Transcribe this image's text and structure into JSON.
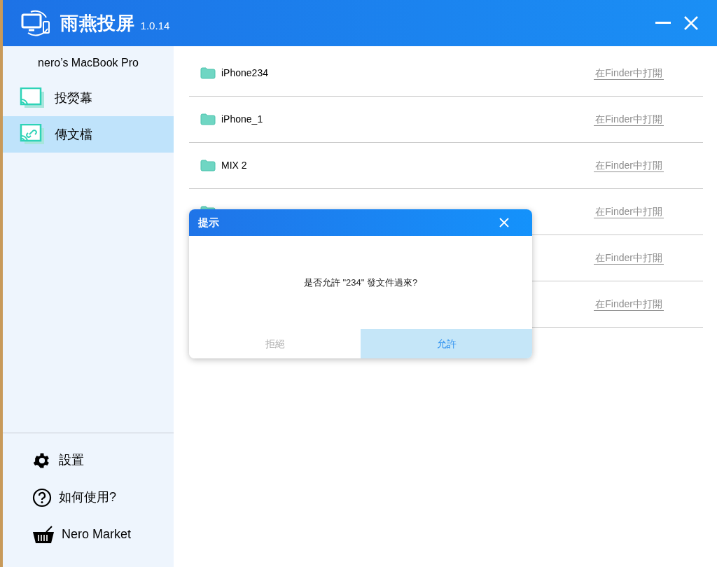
{
  "window": {
    "title": "雨燕投屏",
    "version": "1.0.14"
  },
  "sidebar": {
    "device": "nero’s MacBook Pro",
    "items": [
      {
        "label": "投熒幕",
        "kind": "screen",
        "selected": false
      },
      {
        "label": "傳文檔",
        "kind": "file",
        "selected": true
      }
    ],
    "footer_items": [
      {
        "label": "設置",
        "kind": "settings"
      },
      {
        "label": "如何使用?",
        "kind": "help"
      },
      {
        "label": "Nero Market",
        "kind": "market"
      }
    ]
  },
  "folders": [
    {
      "name": "iPhone234",
      "action": "在Finder中打開"
    },
    {
      "name": "iPhone_1",
      "action": "在Finder中打開"
    },
    {
      "name": "MIX 2",
      "action": "在Finder中打開"
    },
    {
      "action": "在Finder中打開"
    },
    {
      "action": "在Finder中打開"
    },
    {
      "action": "在Finder中打開"
    }
  ],
  "dialog": {
    "title": "提示",
    "message": "是否允許 \"234\" 發文件過來?",
    "buttons": [
      {
        "label": "拒絕",
        "selected": false
      },
      {
        "label": "允許",
        "selected": true
      }
    ]
  }
}
